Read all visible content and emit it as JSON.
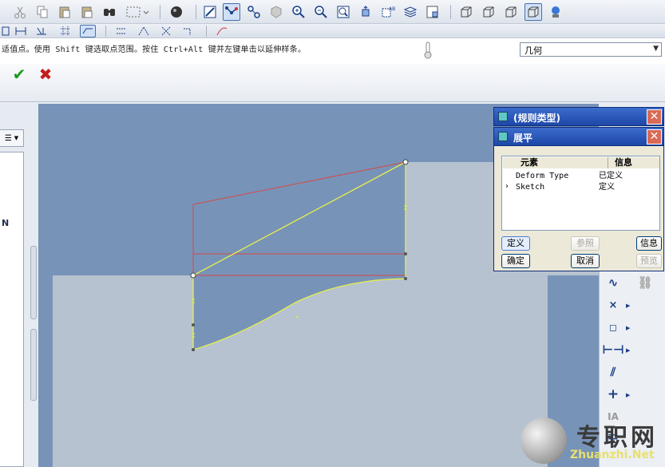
{
  "message_bar": {
    "prompt": "适值点。使用 Shift 键选取点范围。按住 Ctrl+Alt 键并左键单击以延伸样条。",
    "filter_value": "几何"
  },
  "dialog_rule": {
    "title": "(规则类型)"
  },
  "dialog_flatten": {
    "title": "展平",
    "table_headers": [
      "元素",
      "信息"
    ],
    "rows": [
      {
        "element": "Deform Type",
        "info": "已定义"
      },
      {
        "element": "Sketch",
        "info": "定义"
      }
    ],
    "buttons": {
      "define": "定义",
      "reference": "参照",
      "info": "信息",
      "ok": "确定",
      "cancel": "取消",
      "preview": "预览"
    }
  },
  "left_panel": {
    "tree_letter": "N"
  },
  "watermark": {
    "brand": "专职网",
    "url": "Zhuanzhi.Net"
  },
  "colors": {
    "graphics_bg": "#7893b8",
    "solid_face": "#b6c2cf",
    "sketch_yellow": "#e6f04a",
    "sketch_red": "#d44a4a",
    "dialog_title": "#2454b8"
  }
}
